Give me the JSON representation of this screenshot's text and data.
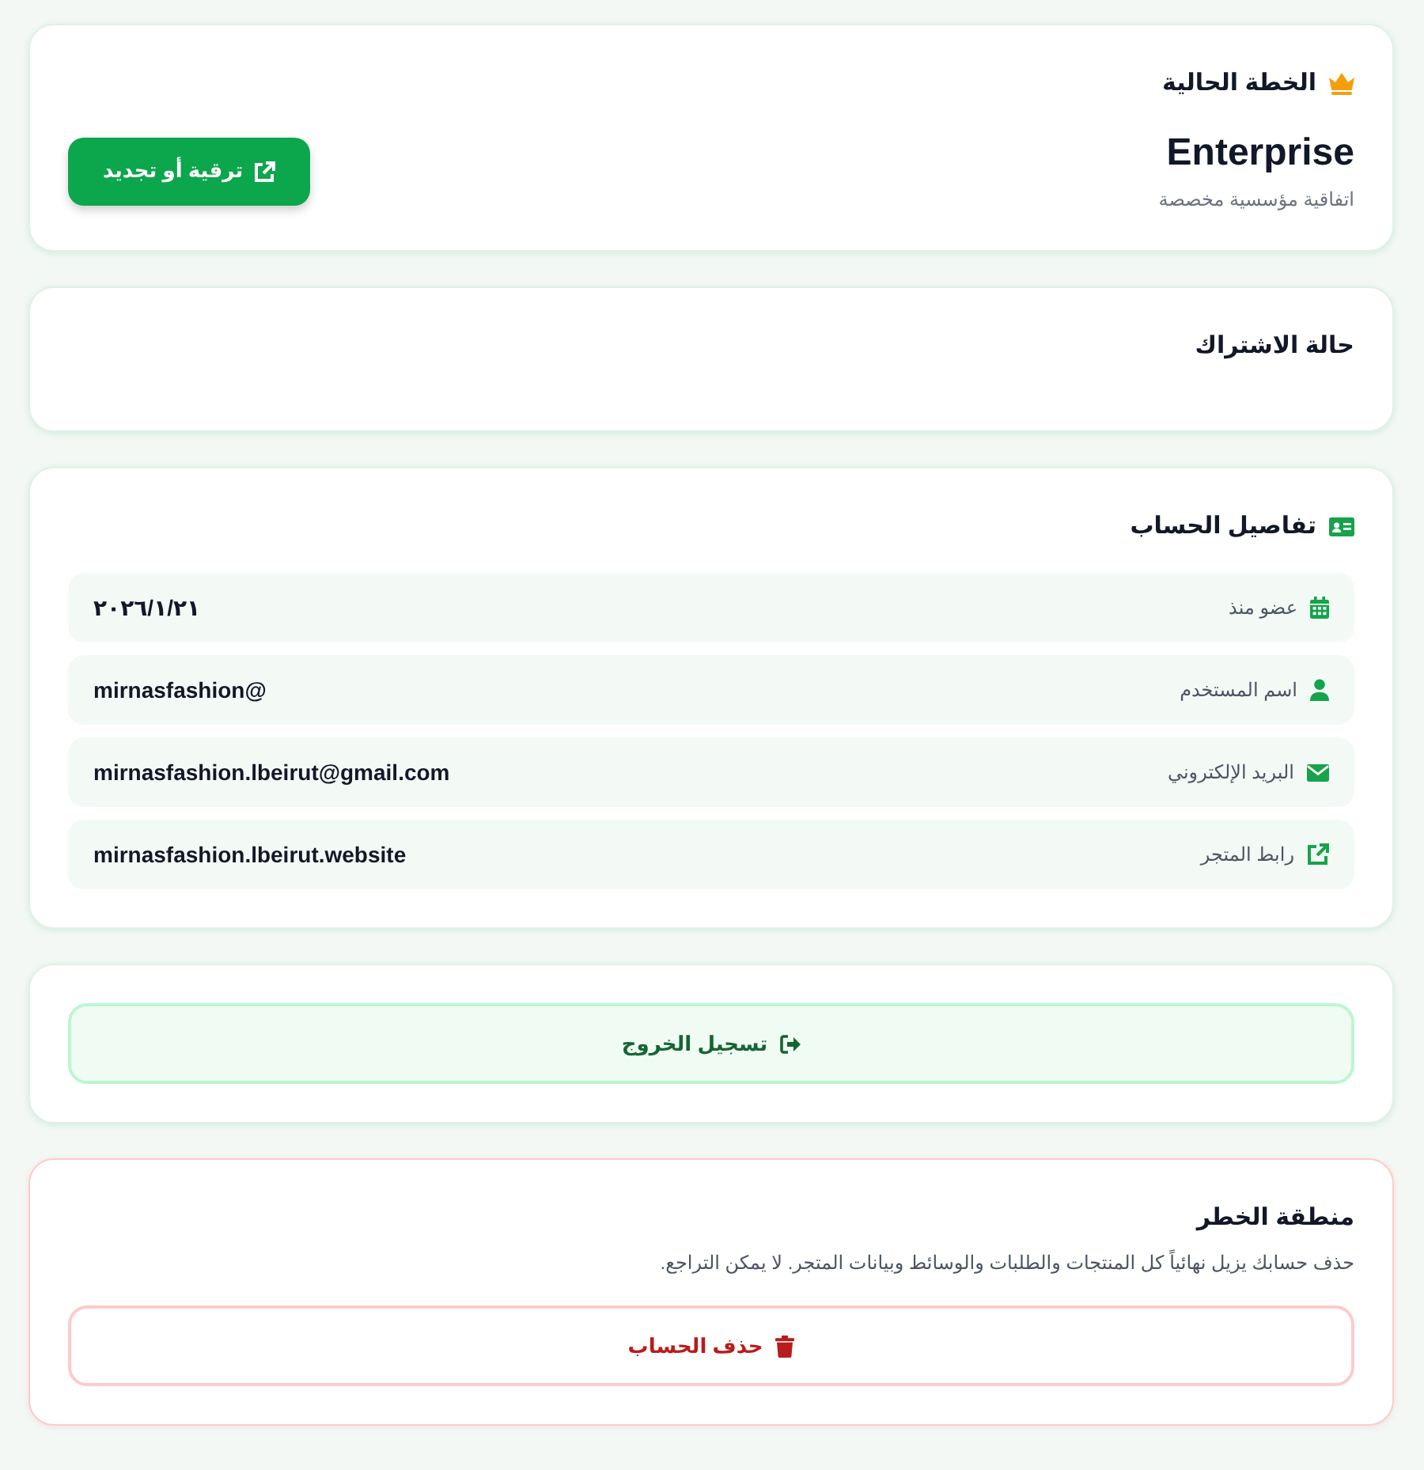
{
  "plan": {
    "title": "الخطة الحالية",
    "name": "Enterprise",
    "description": "اتفاقية مؤسسية مخصصة",
    "action": "ترقية أو تجديد"
  },
  "subscription": {
    "title": "حالة الاشتراك"
  },
  "account": {
    "title": "تفاصيل الحساب",
    "rows": [
      {
        "kind": "date",
        "label": "عضو منذ",
        "value": "٢٠٢٦/١/٢١"
      },
      {
        "kind": "user",
        "label": "اسم المستخدم",
        "value": "@mirnasfashion"
      },
      {
        "kind": "email",
        "label": "البريد الإلكتروني",
        "value": "mirnasfashion.lbeirut@gmail.com"
      },
      {
        "kind": "link",
        "label": "رابط المتجر",
        "value": "mirnasfashion.lbeirut.website"
      }
    ]
  },
  "logout": {
    "label": "تسجيل الخروج"
  },
  "danger_zone": {
    "title": "منطقة الخطر",
    "description": "حذف حسابك يزيل نهائياً كل المنتجات والطلبات والوسائط وبيانات المتجر. لا يمكن التراجع.",
    "action": "حذف الحساب"
  }
}
